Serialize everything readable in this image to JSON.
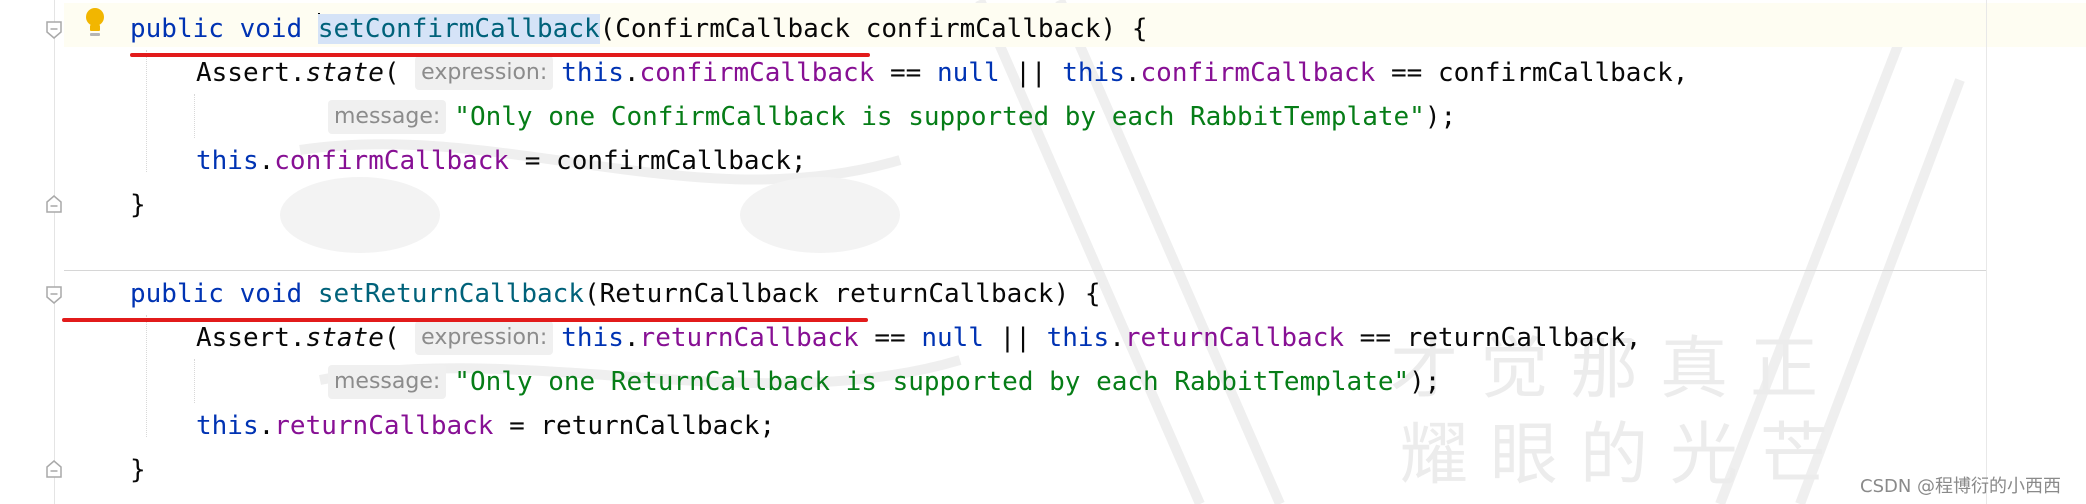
{
  "editor": {
    "method1": {
      "sig_public": "public",
      "sig_void": "void",
      "sig_name": "setConfirmCallback",
      "sig_open": "(ConfirmCallback confirmCallback) {",
      "assert_prefix": "Assert.",
      "assert_method": "state",
      "assert_open": "(",
      "hint_expression": "expression:",
      "this1": "this",
      "dot1": ".",
      "field1": "confirmCallback",
      "op_eq_null": " == ",
      "null_kw": "null",
      "op_or": " || ",
      "this2": "this",
      "dot2": ".",
      "field2": "confirmCallback",
      "op_eq_param": " == confirmCallback,",
      "hint_message": "message:",
      "message_string": "\"Only one ConfirmCallback is supported by each RabbitTemplate\"",
      "message_close": ");",
      "assign_this": "this",
      "assign_dot": ".",
      "assign_field": "confirmCallback",
      "assign_rest": " = confirmCallback;",
      "close_brace": "}"
    },
    "method2": {
      "sig_public": "public",
      "sig_void": "void",
      "sig_name": "setReturnCallback",
      "sig_open": "(ReturnCallback returnCallback) {",
      "assert_prefix": "Assert.",
      "assert_method": "state",
      "assert_open": "(",
      "hint_expression": "expression:",
      "this1": "this",
      "dot1": ".",
      "field1": "returnCallback",
      "op_eq_null": " == ",
      "null_kw": "null",
      "op_or": " || ",
      "this2": "this",
      "dot2": ".",
      "field2": "returnCallback",
      "op_eq_param": " == returnCallback,",
      "hint_message": "message:",
      "message_string": "\"Only one ReturnCallback is supported by each RabbitTemplate\"",
      "message_close": ");",
      "assign_this": "this",
      "assign_dot": ".",
      "assign_field": "returnCallback",
      "assign_rest": " = returnCallback;",
      "close_brace": "}"
    }
  },
  "colors": {
    "keyword": "#0033b3",
    "method_name": "#00627a",
    "field": "#871094",
    "string": "#067d17",
    "annotation_underline": "#e21b1b"
  },
  "icons": [
    "intention-bulb-icon",
    "fold-icon"
  ],
  "watermark": {
    "line1": "才觉那真正",
    "line2": "耀眼的光芒",
    "csdn_credit": "CSDN @程博衍的小西西"
  }
}
